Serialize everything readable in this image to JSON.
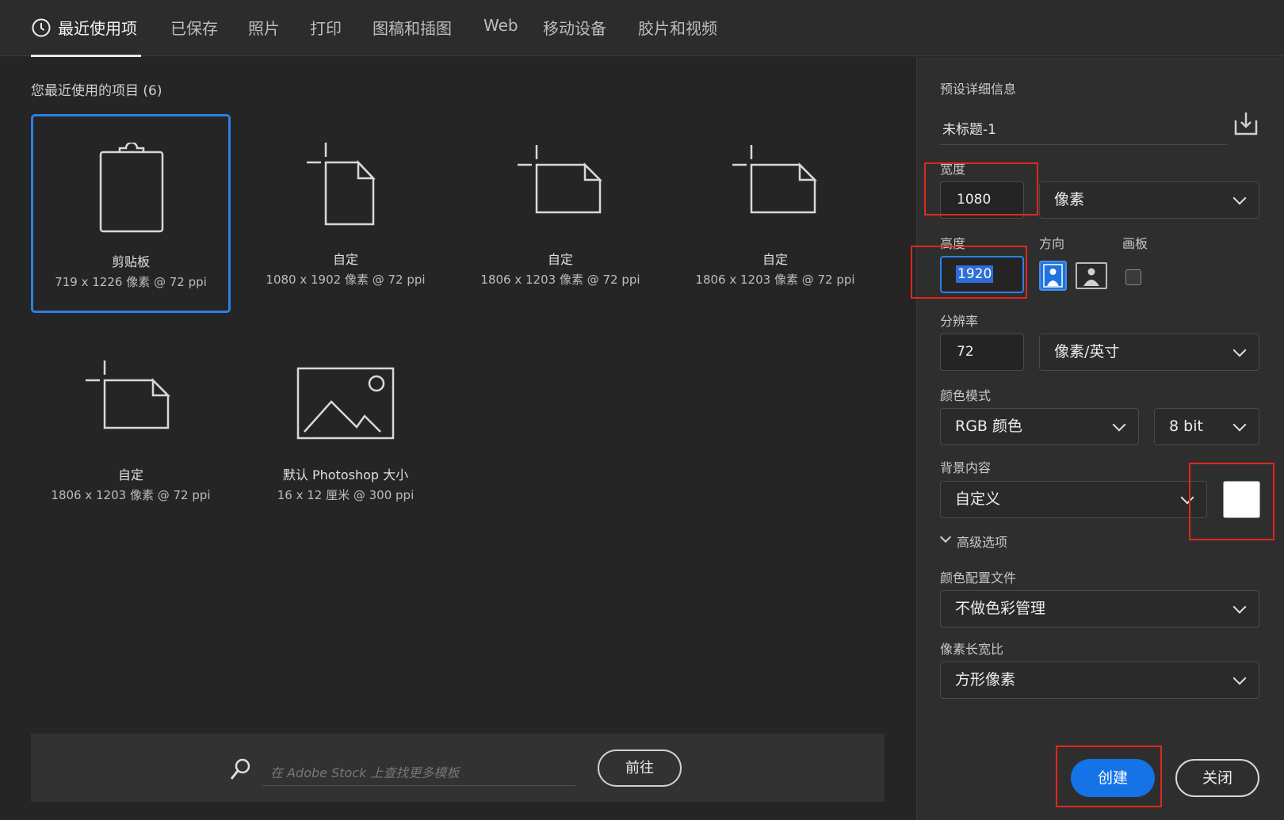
{
  "tabs": [
    {
      "label": "最近使用项",
      "active": true
    },
    {
      "label": "已保存"
    },
    {
      "label": "照片"
    },
    {
      "label": "打印"
    },
    {
      "label": "图稿和插图"
    },
    {
      "label": "Web"
    },
    {
      "label": "移动设备"
    },
    {
      "label": "胶片和视频"
    }
  ],
  "recent": {
    "title": "您最近使用的项目 (6)",
    "items": [
      {
        "name": "剪贴板",
        "size": "719 x 1226 像素 @ 72 ppi",
        "icon": "clipboard-icon",
        "selected": true
      },
      {
        "name": "自定",
        "size": "1080 x 1902 像素 @ 72 ppi",
        "icon": "portrait-document-icon"
      },
      {
        "name": "自定",
        "size": "1806 x 1203 像素 @ 72 ppi",
        "icon": "landscape-document-icon"
      },
      {
        "name": "自定",
        "size": "1806 x 1203 像素 @ 72 ppi",
        "icon": "landscape-document-icon"
      },
      {
        "name": "自定",
        "size": "1806 x 1203 像素 @ 72 ppi",
        "icon": "landscape-document-icon"
      },
      {
        "name": "默认 Photoshop 大小",
        "size": "16 x 12 厘米 @ 300 ppi",
        "icon": "image-icon"
      }
    ]
  },
  "stock": {
    "placeholder": "在 Adobe Stock 上查找更多模板",
    "go_label": "前往"
  },
  "preset": {
    "header": "预设详细信息",
    "doc_title": "未标题-1",
    "width_label": "宽度",
    "width_value": "1080",
    "width_unit": "像素",
    "height_label": "高度",
    "height_value": "1920",
    "orientation_label": "方向",
    "artboard_label": "画板",
    "resolution_label": "分辨率",
    "resolution_value": "72",
    "resolution_unit": "像素/英寸",
    "color_mode_label": "颜色模式",
    "color_mode": "RGB 颜色",
    "bit_depth": "8 bit",
    "background_label": "背景内容",
    "background": "自定义",
    "background_color": "#ffffff",
    "advanced_label": "高级选项",
    "color_profile_label": "颜色配置文件",
    "color_profile": "不做色彩管理",
    "pixel_aspect_label": "像素长宽比",
    "pixel_aspect": "方形像素"
  },
  "buttons": {
    "create": "创建",
    "close": "关闭"
  },
  "colors": {
    "accent": "#1473e6",
    "selection": "#2e7fe6",
    "highlight_box": "#e0281c"
  }
}
